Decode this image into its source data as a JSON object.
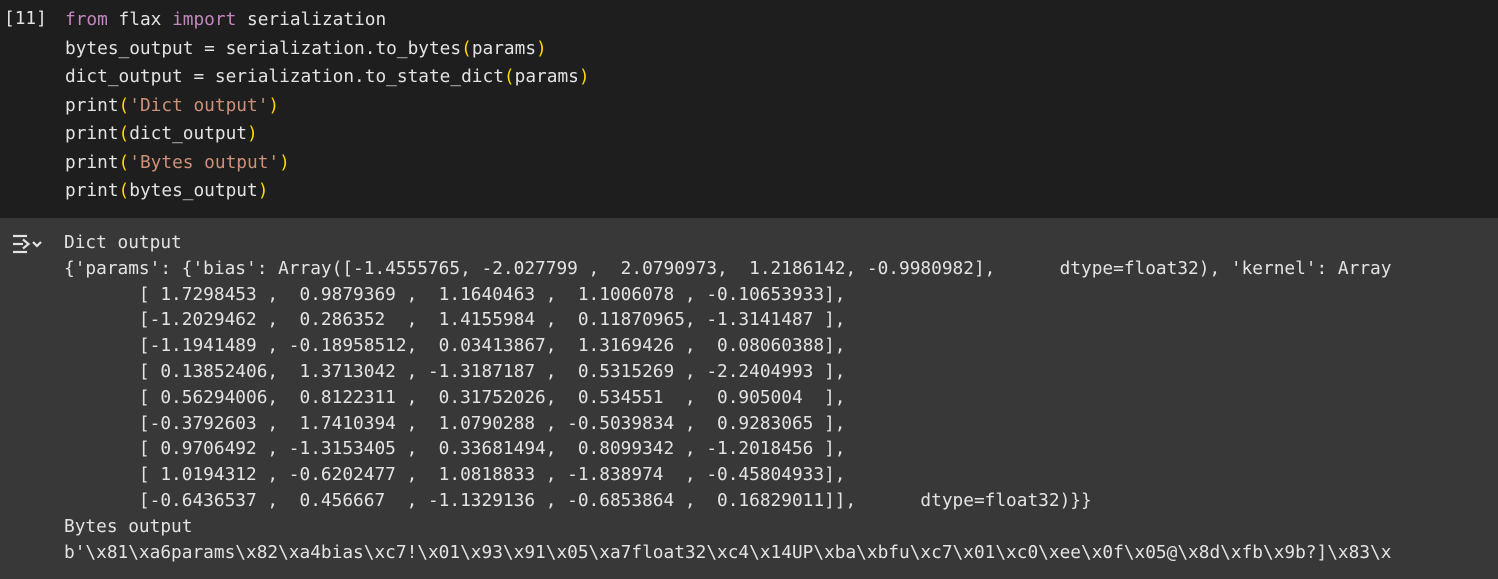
{
  "cell": {
    "execution_count": "[11]",
    "code_lines": [
      [
        {
          "t": "from",
          "c": "kw"
        },
        {
          "t": " flax ",
          "c": "fn"
        },
        {
          "t": "import",
          "c": "kw"
        },
        {
          "t": " serialization",
          "c": "fn"
        }
      ],
      [
        {
          "t": "bytes_output = serialization.to_bytes",
          "c": "fn"
        },
        {
          "t": "(",
          "c": "br1"
        },
        {
          "t": "params",
          "c": "fn"
        },
        {
          "t": ")",
          "c": "br1"
        }
      ],
      [
        {
          "t": "dict_output = serialization.to_state_dict",
          "c": "fn"
        },
        {
          "t": "(",
          "c": "br1"
        },
        {
          "t": "params",
          "c": "fn"
        },
        {
          "t": ")",
          "c": "br1"
        }
      ],
      [
        {
          "t": "print",
          "c": "fn"
        },
        {
          "t": "(",
          "c": "br1"
        },
        {
          "t": "'Dict output'",
          "c": "str"
        },
        {
          "t": ")",
          "c": "br1"
        }
      ],
      [
        {
          "t": "print",
          "c": "fn"
        },
        {
          "t": "(",
          "c": "br1"
        },
        {
          "t": "dict_output",
          "c": "fn"
        },
        {
          "t": ")",
          "c": "br1"
        }
      ],
      [
        {
          "t": "print",
          "c": "fn"
        },
        {
          "t": "(",
          "c": "br1"
        },
        {
          "t": "'Bytes output'",
          "c": "str"
        },
        {
          "t": ")",
          "c": "br1"
        }
      ],
      [
        {
          "t": "print",
          "c": "fn"
        },
        {
          "t": "(",
          "c": "br1"
        },
        {
          "t": "bytes_output",
          "c": "fn"
        },
        {
          "t": ")",
          "c": "br1"
        }
      ]
    ]
  },
  "output": {
    "icon": "output-toggle-icon",
    "lines": [
      "Dict output",
      "{'params': {'bias': Array([-1.4555765, -2.027799 ,  2.0790973,  1.2186142, -0.9980982],      dtype=float32), 'kernel': Array",
      "       [ 1.7298453 ,  0.9879369 ,  1.1640463 ,  1.1006078 , -0.10653933],",
      "       [-1.2029462 ,  0.286352  ,  1.4155984 ,  0.11870965, -1.3141487 ],",
      "       [-1.1941489 , -0.18958512,  0.03413867,  1.3169426 ,  0.08060388],",
      "       [ 0.13852406,  1.3713042 , -1.3187187 ,  0.5315269 , -2.2404993 ],",
      "       [ 0.56294006,  0.8122311 ,  0.31752026,  0.534551  ,  0.905004  ],",
      "       [-0.3792603 ,  1.7410394 ,  1.0790288 , -0.5039834 ,  0.9283065 ],",
      "       [ 0.9706492 , -1.3153405 ,  0.33681494,  0.8099342 , -1.2018456 ],",
      "       [ 1.0194312 , -0.6202477 ,  1.0818833 , -1.838974  , -0.45804933],",
      "       [-0.6436537 ,  0.456667  , -1.1329136 , -0.6853864 ,  0.16829011]],      dtype=float32)}}",
      "Bytes output",
      "b'\\x81\\xa6params\\x82\\xa4bias\\xc7!\\x01\\x93\\x91\\x05\\xa7float32\\xc4\\x14UP\\xba\\xbfu\\xc7\\x01\\xc0\\xee\\x0f\\x05@\\x8d\\xfb\\x9b?]\\x83\\x"
    ]
  }
}
